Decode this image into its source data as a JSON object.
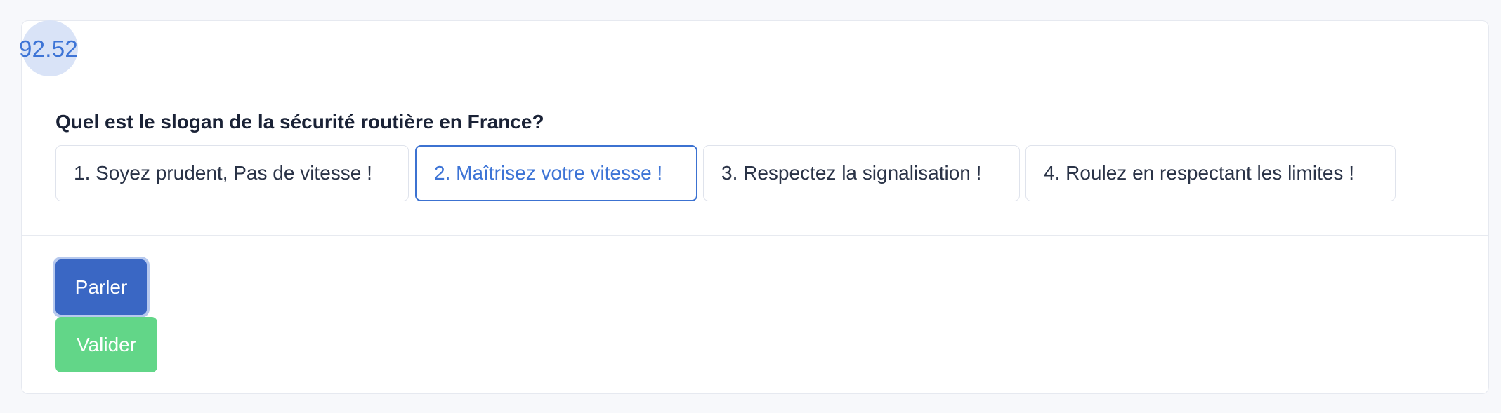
{
  "timer": {
    "value": "92.52"
  },
  "quiz": {
    "question": "Quel est le slogan de la sécurité routière en France?",
    "options": [
      {
        "label": "1. Soyez prudent, Pas de vitesse !",
        "selected": false
      },
      {
        "label": "2. Maîtrisez votre vitesse !",
        "selected": true
      },
      {
        "label": "3. Respectez la signalisation !",
        "selected": false
      },
      {
        "label": "4. Roulez en respectant les limites !",
        "selected": false
      }
    ]
  },
  "actions": {
    "speak_label": "Parler",
    "submit_label": "Valider"
  },
  "colors": {
    "accent": "#3d74d6",
    "speak_button": "#3a67c4",
    "submit_button": "#62d688",
    "timer_bubble": "#d9e3f7"
  }
}
